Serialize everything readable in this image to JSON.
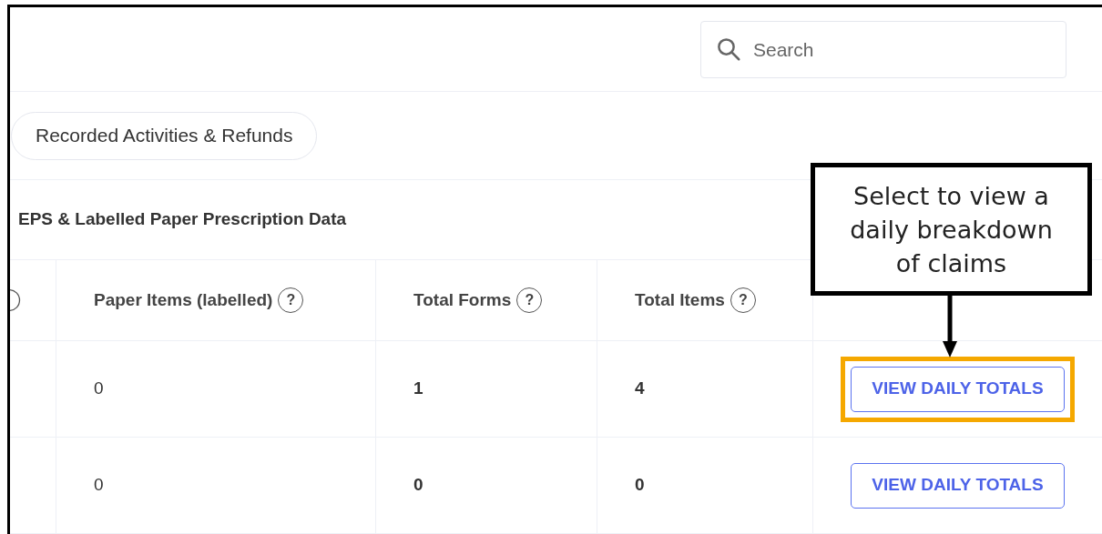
{
  "search": {
    "placeholder": "Search"
  },
  "filter_chip": {
    "label": "Recorded Activities & Refunds"
  },
  "section": {
    "title": "EPS & Labelled Paper Prescription Data"
  },
  "table": {
    "columns": [
      {
        "label": "Paper Items (labelled)",
        "help": "?",
        "bold": false
      },
      {
        "label": "Total Forms",
        "help": "?",
        "bold": true
      },
      {
        "label": "Total Items",
        "help": "?",
        "bold": true
      }
    ],
    "rows": [
      {
        "cells": [
          "0",
          "1",
          "4"
        ],
        "action": "VIEW DAILY TOTALS",
        "highlighted": true
      },
      {
        "cells": [
          "0",
          "0",
          "0"
        ],
        "action": "VIEW DAILY TOTALS",
        "highlighted": false
      }
    ]
  },
  "annotation": {
    "lines": [
      "Select to view a",
      "daily breakdown",
      "of claims"
    ]
  }
}
